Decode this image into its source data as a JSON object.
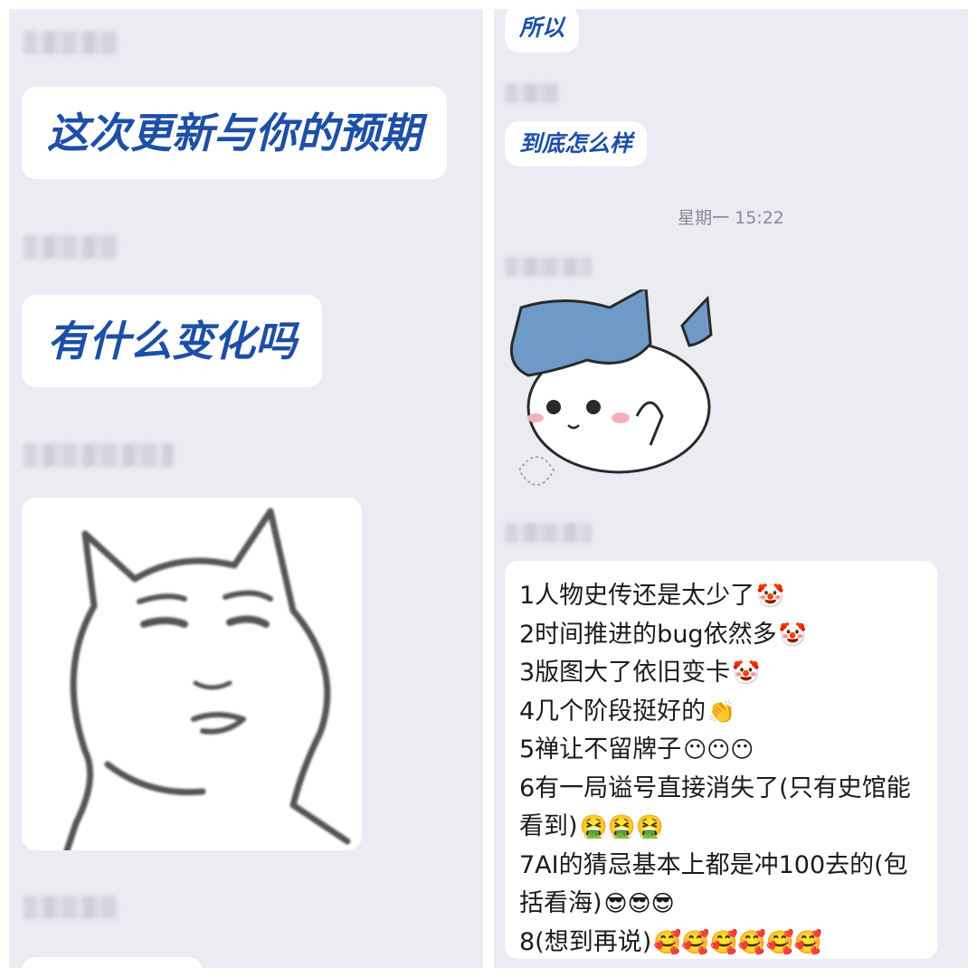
{
  "left": {
    "messages": [
      "这次更新与你的预期",
      "有什么变化吗"
    ]
  },
  "right": {
    "messages": [
      "所以",
      "到底怎么样"
    ],
    "timestamp": "星期一 15:22",
    "list": [
      {
        "text": "1人物史传还是太少了",
        "emoji": "🤡"
      },
      {
        "text": "2时间推进的bug依然多",
        "emoji": "🤡"
      },
      {
        "text": "3版图大了依旧变卡",
        "emoji": "🤡"
      },
      {
        "text": "4几个阶段挺好的",
        "emoji": "👏"
      },
      {
        "text": "5禅让不留牌子",
        "emoji": "😶😶😶"
      },
      {
        "text": "6有一局谥号直接消失了(只有史馆能看到)",
        "emoji": "🤮🤮🤮"
      },
      {
        "text": "7AI的猜忌基本上都是冲100去的(包括看海)",
        "emoji": "😎😎😎"
      },
      {
        "text": "8(想到再说)",
        "emoji": "🥰🥰🥰🥰🥰🥰"
      }
    ]
  }
}
